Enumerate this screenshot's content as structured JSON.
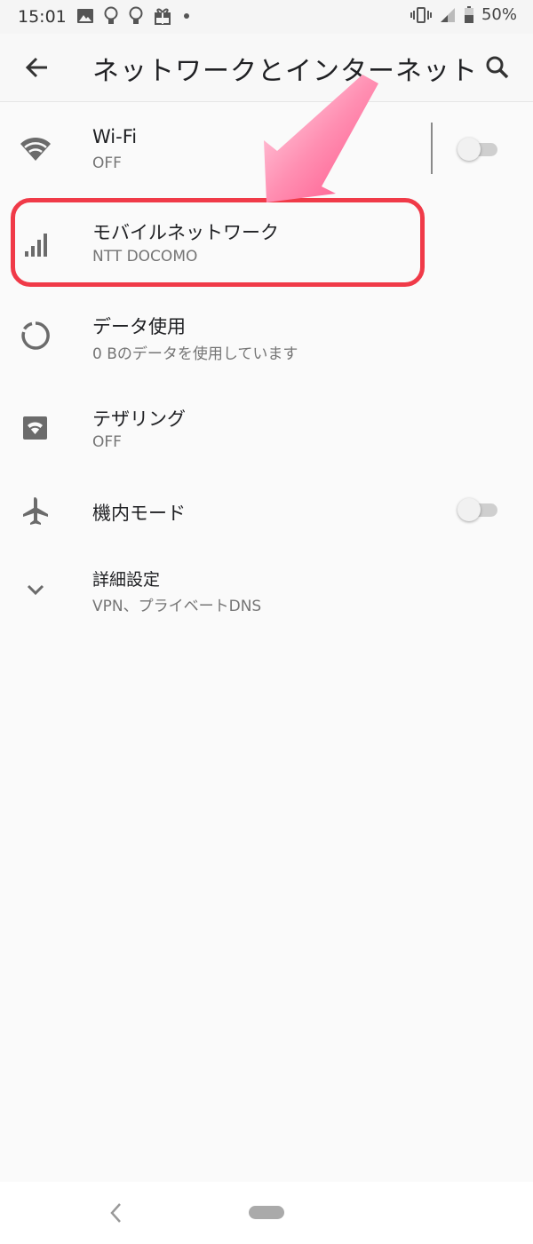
{
  "status_bar": {
    "time": "15:01",
    "left_icons": [
      "image-icon",
      "lightbulb-icon",
      "lightbulb-icon",
      "gift-icon",
      "dot-icon"
    ],
    "right_icons": [
      "vibrate-icon",
      "signal-icon",
      "battery-icon"
    ],
    "battery_text": "50%"
  },
  "app_bar": {
    "title": "ネットワークとインターネット",
    "back_icon": "arrow-back-icon",
    "search_icon": "search-icon"
  },
  "settings": [
    {
      "id": "wifi",
      "icon": "wifi-icon",
      "title": "Wi-Fi",
      "subtitle": "OFF",
      "toggle": false
    },
    {
      "id": "mobile",
      "icon": "signal-bars-icon",
      "title": "モバイルネットワーク",
      "subtitle": "NTT DOCOMO"
    },
    {
      "id": "data",
      "icon": "data-usage-icon",
      "title": "データ使用",
      "subtitle": "0 Bのデータを使用しています"
    },
    {
      "id": "tethering",
      "icon": "hotspot-icon",
      "title": "テザリング",
      "subtitle": "OFF"
    },
    {
      "id": "airplane",
      "icon": "airplane-icon",
      "title": "機内モード",
      "toggle": false
    },
    {
      "id": "advanced",
      "icon": "chevron-down-icon",
      "title": "詳細設定",
      "subtitle": "VPN、プライベートDNS"
    }
  ],
  "annotation": {
    "highlight_color": "#f03a48",
    "arrow_color": "#ff4f86"
  },
  "nav_bar": {
    "back_icon": "nav-back-icon",
    "home_icon": "home-pill-icon"
  }
}
